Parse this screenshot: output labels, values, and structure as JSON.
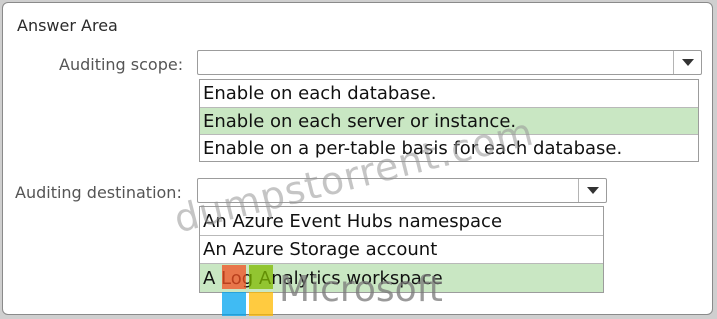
{
  "answer_area": {
    "title": "Answer Area"
  },
  "auditing_scope": {
    "label": "Auditing scope:",
    "selected_value": "",
    "options": [
      "Enable on each database.",
      "Enable on each server or instance.",
      "Enable on a per-table basis for each database."
    ],
    "selected_index": 1
  },
  "auditing_destination": {
    "label": "Auditing destination:",
    "selected_value": "",
    "options": [
      "An Azure Event Hubs namespace",
      "An Azure Storage account",
      "A Log Analytics workspace"
    ],
    "selected_index": 2
  },
  "watermark": {
    "text": "dumpstorrent.com",
    "brand_text": "Microsoft"
  },
  "colors": {
    "selected_row": "#c9e7c3",
    "ms_red": "#f25022",
    "ms_green": "#7fba00",
    "ms_blue": "#00a4ef",
    "ms_yellow": "#ffb900"
  },
  "icons": {
    "dropdown": "chevron-down-icon",
    "logo": "microsoft-logo-icon"
  }
}
